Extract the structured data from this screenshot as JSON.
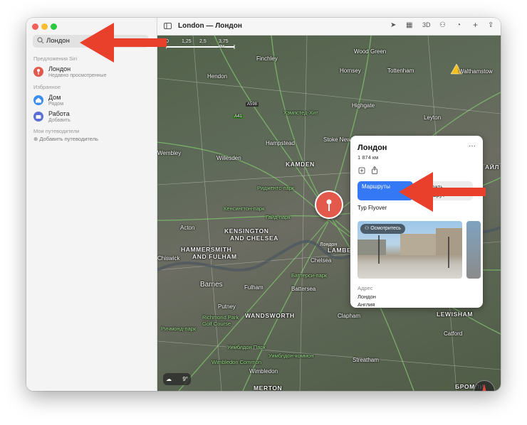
{
  "search": {
    "value": "Лондон"
  },
  "sidebar": {
    "siri_section": "Предложения Siri",
    "siri_item": {
      "title": "Лондон",
      "subtitle": "Недавно просмотренные"
    },
    "favorites_section": "Избранное",
    "favorites": [
      {
        "title": "Дом",
        "subtitle": "Рядом"
      },
      {
        "title": "Работа",
        "subtitle": "Добавить"
      }
    ],
    "guides_section": "Мои путеводители",
    "add_guide": "Добавить путеводитель"
  },
  "toolbar": {
    "title": "London — Лондон",
    "threed": "3D"
  },
  "scale": {
    "labels": [
      "0",
      "1,25",
      "2,5",
      "3,75 км"
    ]
  },
  "map_labels": {
    "finchley": "Finchley",
    "woodgreen": "Wood Green",
    "hornsey": "Hornsey",
    "tottenham": "Tottenham",
    "walthamstow": "Walthamstow",
    "hendon": "Hendon",
    "a598": "A598",
    "highgate": "Highgate",
    "a41": "A41",
    "a503": "A503",
    "leyton": "Leyton",
    "hampstead": "Hampstead",
    "stokenewington": "Stoke Newington",
    "willesden": "Willesden",
    "camden": "KAMDEN",
    "kamden_area": "АЙЛ",
    "wembley": "Wembley",
    "acton": "Acton",
    "kensington": "KENSINGTON",
    "andchelsea": "AND CHELSEA",
    "hammersmith": "HAMMERSMITH",
    "andfulham": "AND FULHAM",
    "chiswick": "Chiswick",
    "chelsea": "Chelsea",
    "barnes": "Barnes",
    "fulham": "Fulham",
    "battersea": "Battersea",
    "putney": "Putney",
    "wandsworth": "WANDSWORTH",
    "clapham": "Clapham",
    "lambeth": "LAMBETH",
    "streatham": "Streatham",
    "wimbledon": "Wimbledon",
    "merton": "MERTON",
    "lewisham": "LEWISHAM",
    "catford": "Catford",
    "bromley": "БРОМЛИ",
    "park1": "Уимблдон-коммон",
    "park2": "Richmond Park Golf Course",
    "park3": "Ричмонд-парк",
    "park4": "Риджентс-парк",
    "park5": "Гайд-парк",
    "park6": "Баттерси-парк",
    "park7": "Уимблдон Парк",
    "park8": "Хэмпстед-Хит",
    "park9": "Кенсингтон-парк",
    "park10": "Wimbledon Common"
  },
  "pin_label": "Лондон",
  "card": {
    "title": "Лондон",
    "distance": "1 874 км",
    "routes_button": "Маршруты",
    "create_route_button": "Создать маршрут",
    "flyover": "Тур Flyover",
    "look_around": "Осмотритесь",
    "address_header": "Адрес",
    "address_lines": [
      "Лондон",
      "Англия"
    ]
  },
  "weather": {
    "temp": "9°"
  },
  "colors": {
    "accent": "#3478f6",
    "pin": "#e35a4c",
    "arrow": "#e8402b"
  }
}
